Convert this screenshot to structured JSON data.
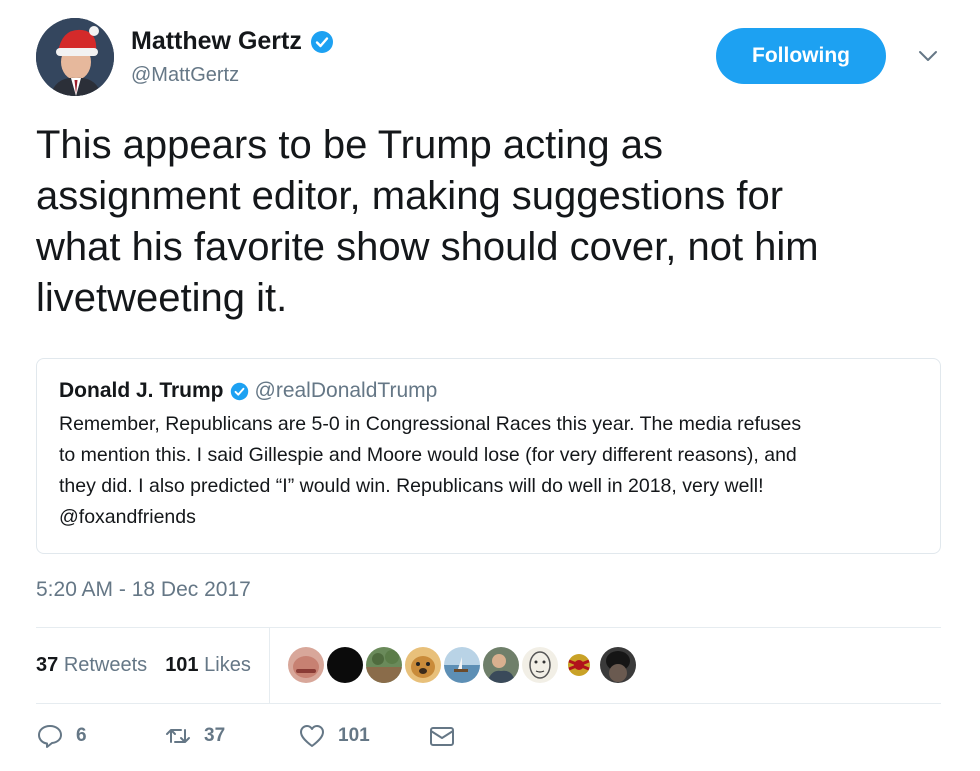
{
  "author": {
    "name": "Matthew Gertz",
    "handle": "@MattGertz",
    "avatar_icon": "santa-hat-profile-photo"
  },
  "follow_button": {
    "label": "Following",
    "color": "#1da1f2"
  },
  "tweet": {
    "lines": [
      "This appears to be Trump acting as",
      "assignment editor, making suggestions for",
      "what his favorite show should cover, not him",
      "livetweeting it."
    ],
    "timestamp": "5:20 AM - 18 Dec 2017"
  },
  "quoted_tweet": {
    "name": "Donald J. Trump",
    "handle": "@realDonaldTrump",
    "lines": [
      "Remember, Republicans are 5-0 in Congressional Races this year. The media refuses",
      "to mention this. I said Gillespie and Moore would lose (for very different reasons), and",
      "they did. I also predicted  “I” would win. Republicans will do well in 2018, very well!",
      "@foxandfriends"
    ]
  },
  "stats": {
    "retweets_count": "37",
    "retweets_label": "Retweets",
    "likes_count": "101",
    "likes_label": "Likes"
  },
  "liker_avatars": [
    "face-1",
    "face-2",
    "face-3",
    "face-4",
    "face-5",
    "face-6",
    "face-7",
    "face-8",
    "face-9"
  ],
  "actions": {
    "reply_count": "6",
    "retweet_count": "37",
    "like_count": "101"
  },
  "colors": {
    "accent": "#1da1f2",
    "muted": "#657786",
    "text": "#14171a"
  }
}
